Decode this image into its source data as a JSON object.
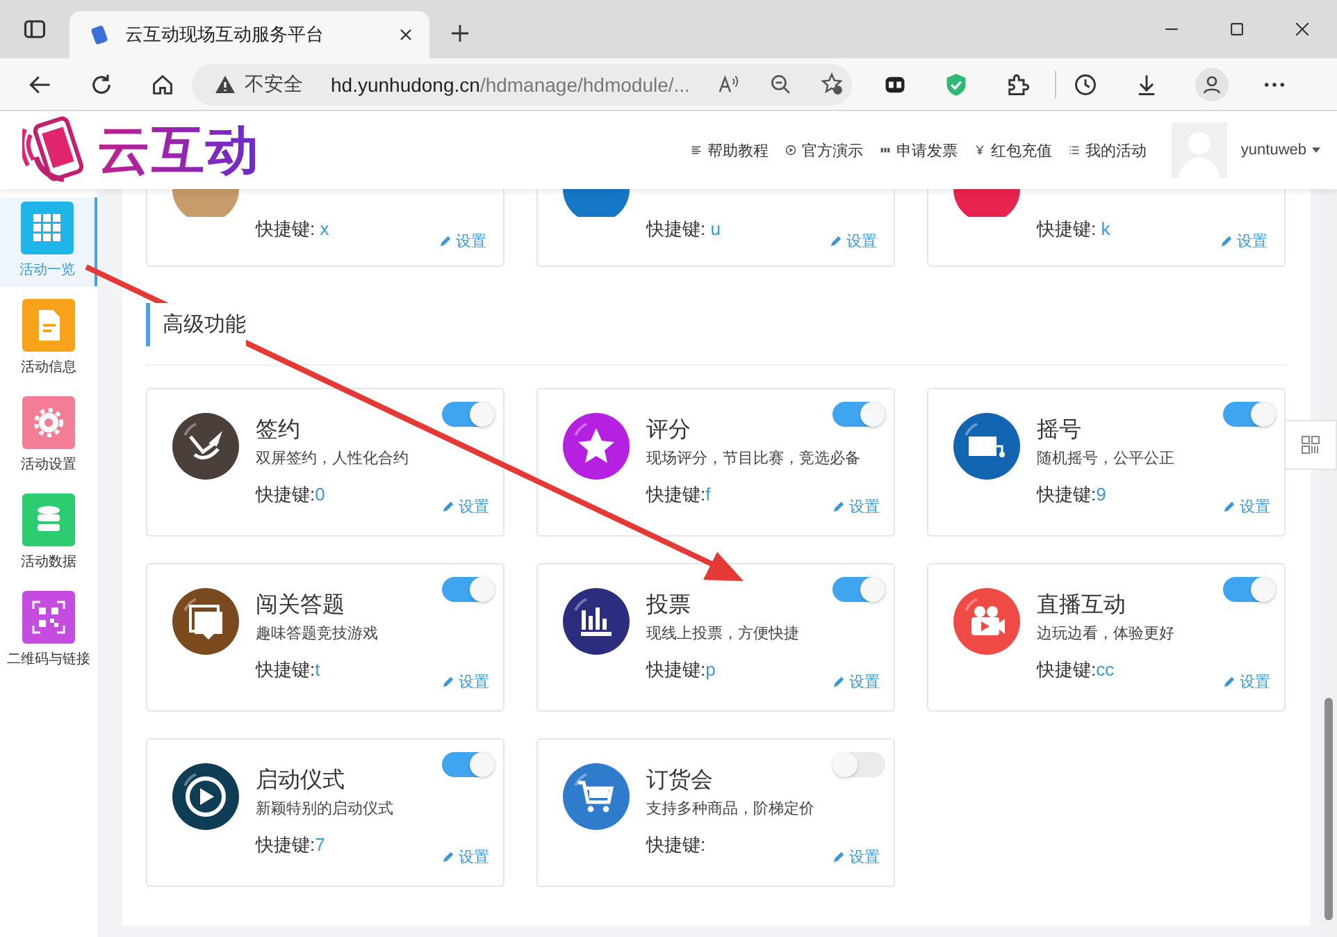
{
  "browser": {
    "tab_title": "云互动现场互动服务平台",
    "security": "不安全",
    "url_host": "hd.yunhudong.cn",
    "url_path": "/hdmanage/hdmodule/..."
  },
  "header": {
    "logo": "云互动",
    "nav": [
      "帮助教程",
      "官方演示",
      "申请发票",
      "红包充值",
      "我的活动"
    ],
    "user": "yuntuweb"
  },
  "sidebar": [
    {
      "label": "活动一览",
      "selected": true
    },
    {
      "label": "活动信息",
      "selected": false
    },
    {
      "label": "活动设置",
      "selected": false
    },
    {
      "label": "活动数据",
      "selected": false
    },
    {
      "label": "二维码与链接",
      "selected": false
    }
  ],
  "top_cards": [
    {
      "shortcut_label": "快捷键:",
      "shortcut": "x",
      "settings": "设置"
    },
    {
      "shortcut_label": "快捷键:",
      "shortcut": "u",
      "settings": "设置"
    },
    {
      "shortcut_label": "快捷键:",
      "shortcut": "k",
      "settings": "设置"
    }
  ],
  "section_title": "高级功能",
  "cards": [
    {
      "title": "签约",
      "description": "双屏签约，人性化合约",
      "shortcut_label": "快捷键:",
      "shortcut": "0",
      "settings": "设置",
      "on": true
    },
    {
      "title": "评分",
      "description": "现场评分，节目比赛，竞选必备",
      "shortcut_label": "快捷键:",
      "shortcut": "f",
      "settings": "设置",
      "on": true
    },
    {
      "title": "摇号",
      "description": "随机摇号，公平公正",
      "shortcut_label": "快捷键:",
      "shortcut": "9",
      "settings": "设置",
      "on": true
    },
    {
      "title": "闯关答题",
      "description": "趣味答题竞技游戏",
      "shortcut_label": "快捷键:",
      "shortcut": "t",
      "settings": "设置",
      "on": true
    },
    {
      "title": "投票",
      "description": "现线上投票，方便快捷",
      "shortcut_label": "快捷键:",
      "shortcut": "p",
      "settings": "设置",
      "on": true
    },
    {
      "title": "直播互动",
      "description": "边玩边看，体验更好",
      "shortcut_label": "快捷键:",
      "shortcut": "cc",
      "settings": "设置",
      "on": true
    },
    {
      "title": "启动仪式",
      "description": "新颖特别的启动仪式",
      "shortcut_label": "快捷键:",
      "shortcut": "7",
      "settings": "设置",
      "on": true
    },
    {
      "title": "订货会",
      "description": "支持多种商品，阶梯定价",
      "shortcut_label": "快捷键:",
      "settings": "设置",
      "on": false
    }
  ]
}
